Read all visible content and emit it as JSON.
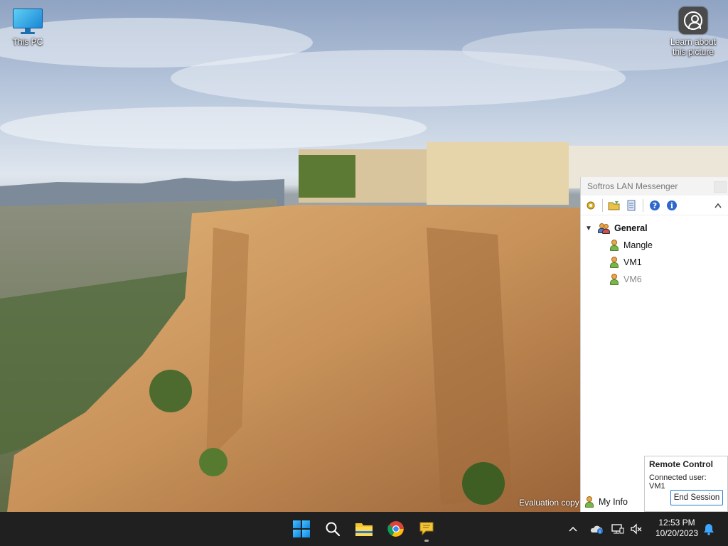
{
  "desktop": {
    "icons": [
      {
        "label": "This PC",
        "icon": "monitor-icon"
      },
      {
        "label": "Learn about this picture",
        "icon": "learn-picture-icon"
      }
    ],
    "watermark": "Evaluation copy"
  },
  "messenger": {
    "title": "Softros LAN Messenger",
    "toolbar": [
      "settings-gear-icon",
      "open-folder-icon",
      "message-history-icon",
      "help-icon",
      "info-icon",
      "chevron-up-icon"
    ],
    "group": {
      "name": "General",
      "expanded": true
    },
    "users": [
      {
        "name": "Mangle",
        "status": "online"
      },
      {
        "name": "VM1",
        "status": "online"
      },
      {
        "name": "VM6",
        "status": "offline"
      }
    ],
    "footer_label": "My Info"
  },
  "remote_control": {
    "title": "Remote Control",
    "connected_text": "Connected user: VM1",
    "end_button": "End Session"
  },
  "taskbar": {
    "apps": [
      "windows-start-icon",
      "search-icon",
      "file-explorer-icon",
      "chrome-icon",
      "softros-messenger-icon"
    ],
    "tray": [
      "chevron-up-icon",
      "onedrive-icon",
      "network-icon",
      "volume-muted-icon",
      "notification-bell-icon"
    ],
    "time": "12:53 PM",
    "date": "10/20/2023"
  },
  "colors": {
    "taskbar": "#202020",
    "accent": "#2a7bd4"
  }
}
